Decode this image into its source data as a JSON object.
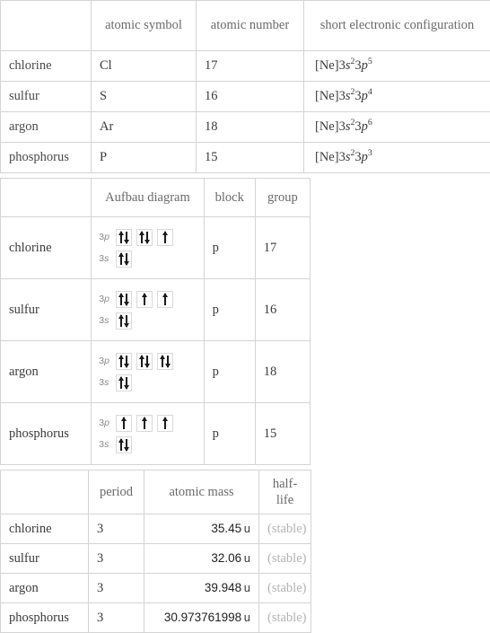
{
  "table1": {
    "headers": [
      "",
      "atomic symbol",
      "atomic number",
      "short electronic configuration"
    ],
    "rows": [
      {
        "name": "chlorine",
        "symbol": "Cl",
        "number": "17",
        "config_base": "[Ne]3",
        "config": {
          "s_letter": "s",
          "s_sup": "2",
          "p_pre": "3",
          "p_letter": "p",
          "p_sup": "5"
        }
      },
      {
        "name": "sulfur",
        "symbol": "S",
        "number": "16",
        "config_base": "[Ne]3",
        "config": {
          "s_letter": "s",
          "s_sup": "2",
          "p_pre": "3",
          "p_letter": "p",
          "p_sup": "4"
        }
      },
      {
        "name": "argon",
        "symbol": "Ar",
        "number": "18",
        "config_base": "[Ne]3",
        "config": {
          "s_letter": "s",
          "s_sup": "2",
          "p_pre": "3",
          "p_letter": "p",
          "p_sup": "6"
        }
      },
      {
        "name": "phosphorus",
        "symbol": "P",
        "number": "15",
        "config_base": "[Ne]3",
        "config": {
          "s_letter": "s",
          "s_sup": "2",
          "p_pre": "3",
          "p_letter": "p",
          "p_sup": "3"
        }
      }
    ]
  },
  "table2": {
    "headers": [
      "",
      "Aufbau diagram",
      "block",
      "group"
    ],
    "p_label_num": "3",
    "p_label_letter": "p",
    "s_label_num": "3",
    "s_label_letter": "s",
    "rows": [
      {
        "name": "chlorine",
        "p_orbitals": [
          "updown",
          "updown",
          "up"
        ],
        "s_orbitals": [
          "updown"
        ],
        "block": "p",
        "group": "17"
      },
      {
        "name": "sulfur",
        "p_orbitals": [
          "updown",
          "up",
          "up"
        ],
        "s_orbitals": [
          "updown"
        ],
        "block": "p",
        "group": "16"
      },
      {
        "name": "argon",
        "p_orbitals": [
          "updown",
          "updown",
          "updown"
        ],
        "s_orbitals": [
          "updown"
        ],
        "block": "p",
        "group": "18"
      },
      {
        "name": "phosphorus",
        "p_orbitals": [
          "up",
          "up",
          "up"
        ],
        "s_orbitals": [
          "updown"
        ],
        "block": "p",
        "group": "15"
      }
    ]
  },
  "table3": {
    "headers": [
      "",
      "period",
      "atomic mass",
      "half-life"
    ],
    "mass_unit": "u",
    "rows": [
      {
        "name": "chlorine",
        "period": "3",
        "mass": "35.45",
        "halflife": "(stable)"
      },
      {
        "name": "sulfur",
        "period": "3",
        "mass": "32.06",
        "halflife": "(stable)"
      },
      {
        "name": "argon",
        "period": "3",
        "mass": "39.948",
        "halflife": "(stable)"
      },
      {
        "name": "phosphorus",
        "period": "3",
        "mass": "30.973761998",
        "halflife": "(stable)"
      }
    ]
  }
}
